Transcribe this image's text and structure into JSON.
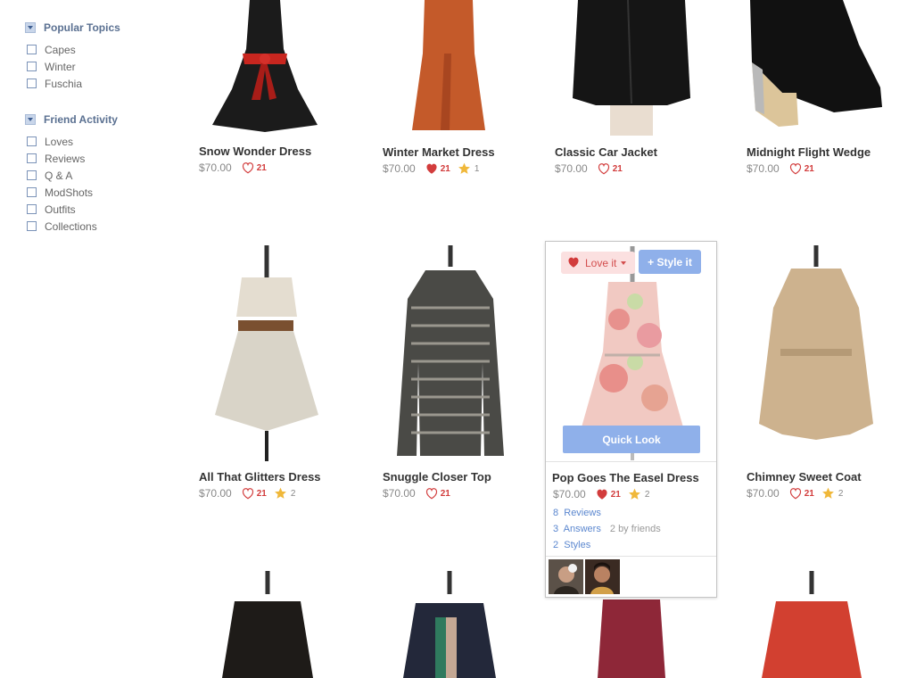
{
  "sidebar": {
    "groups": [
      {
        "title": "Popular Topics",
        "items": [
          "Capes",
          "Winter",
          "Fuschia"
        ]
      },
      {
        "title": "Friend Activity",
        "items": [
          "Loves",
          "Reviews",
          "Q & A",
          "ModShots",
          "Outfits",
          "Collections"
        ]
      }
    ]
  },
  "products": [
    {
      "name": "Snow Wonder Dress",
      "price": "$70.00",
      "loves": "21"
    },
    {
      "name": "Winter Market Dress",
      "price": "$70.00",
      "loves": "21",
      "stars": "1"
    },
    {
      "name": "Classic Car Jacket",
      "price": "$70.00",
      "loves": "21"
    },
    {
      "name": "Midnight Flight Wedge",
      "price": "$70.00",
      "loves": "21"
    },
    {
      "name": "All That Glitters Dress",
      "price": "$70.00",
      "loves": "21",
      "stars": "2"
    },
    {
      "name": "Snuggle Closer Top",
      "price": "$70.00",
      "loves": "21"
    },
    {
      "name": "Pop Goes The Easel Dress",
      "price": "$70.00",
      "loves": "21",
      "stars": "2"
    },
    {
      "name": "Chimney Sweet Coat",
      "price": "$70.00",
      "loves": "21",
      "stars": "2"
    }
  ],
  "hover_card": {
    "love_label": "Love it",
    "style_label": "+ Style it",
    "quick_look_label": "Quick Look",
    "reviews_count": "8",
    "reviews_label": "Reviews",
    "answers_count": "3",
    "answers_label": "Answers",
    "answers_friends": "2 by friends",
    "styles_count": "2",
    "styles_label": "Styles"
  },
  "colors": {
    "accent_blue": "#8fb0ea",
    "love_red": "#d23c3c",
    "star_gold": "#f0b83a",
    "sidebar_heading": "#5a7091"
  },
  "icons": {
    "filter_toggle": "triangle-down-icon",
    "love": "heart-icon",
    "review_star": "star-icon"
  }
}
